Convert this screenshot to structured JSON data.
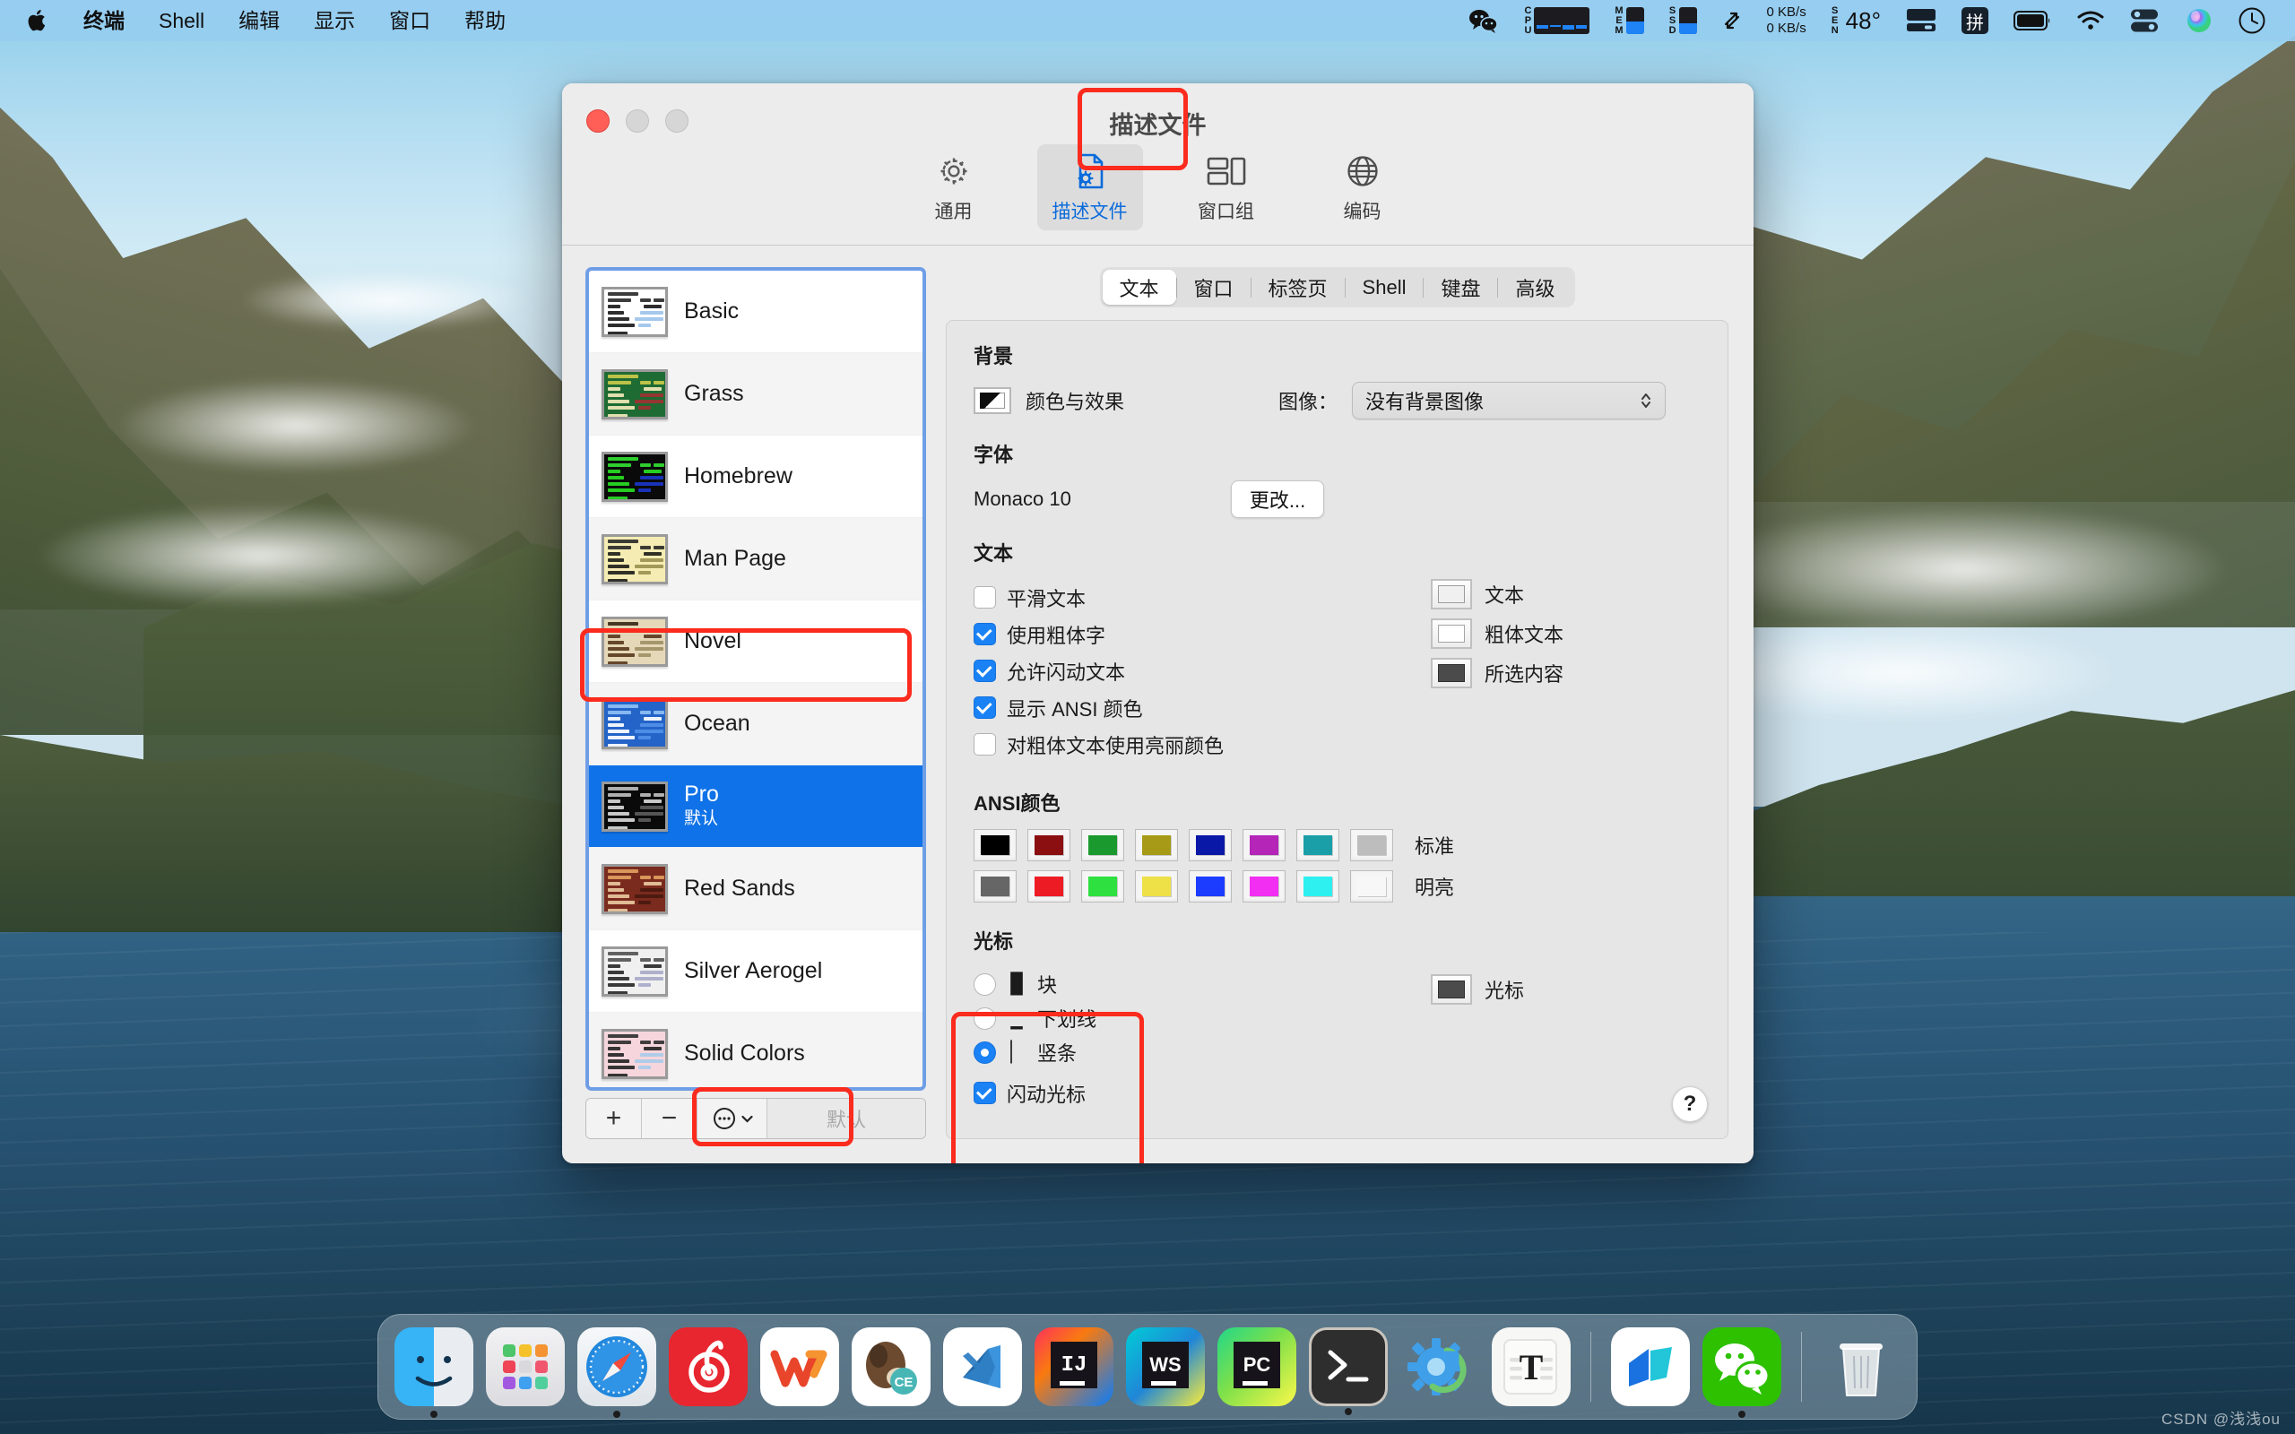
{
  "menubar": {
    "apple_icon": "apple-logo-icon",
    "items": [
      {
        "label": "终端",
        "bold": true
      },
      {
        "label": "Shell",
        "bold": false
      },
      {
        "label": "编辑",
        "bold": false
      },
      {
        "label": "显示",
        "bold": false
      },
      {
        "label": "窗口",
        "bold": false
      },
      {
        "label": "帮助",
        "bold": false
      }
    ],
    "status": {
      "wechat_icon": "wechat-icon",
      "cpu_label": "CPU",
      "mem_label": "MEM",
      "ssd_label": "SSD",
      "net_up": "0 KB/s",
      "net_down": "0 KB/s",
      "sen_label": "SEN",
      "temperature": "48°",
      "display_icon": "display-icon",
      "input_method": "拼",
      "battery_icon": "battery-icon",
      "wifi_icon": "wifi-icon",
      "control_center_icon": "control-center-icon",
      "siri_icon": "siri-icon",
      "clock_icon": "clock-icon"
    }
  },
  "window": {
    "title": "描述文件",
    "traffic_lights": [
      "close-button",
      "minimize-button",
      "zoom-button"
    ],
    "toolbar": [
      {
        "label": "通用",
        "icon": "gear-icon",
        "active": false
      },
      {
        "label": "描述文件",
        "icon": "profile-document-icon",
        "active": true
      },
      {
        "label": "窗口组",
        "icon": "window-group-icon",
        "active": false
      },
      {
        "label": "编码",
        "icon": "globe-icon",
        "active": false
      }
    ]
  },
  "profiles": {
    "items": [
      {
        "name": "Basic",
        "subtitle": "",
        "selected": false,
        "bg": "#ffffff",
        "fg": "#1b1b1b",
        "accent": "#9dc4ea",
        "hdr": "#2b2b2b"
      },
      {
        "name": "Grass",
        "subtitle": "",
        "selected": false,
        "bg": "#1e6b33",
        "fg": "#f2e9b8",
        "accent": "#9e3232",
        "hdr": "#caca4a"
      },
      {
        "name": "Homebrew",
        "subtitle": "",
        "selected": false,
        "bg": "#0a0a0a",
        "fg": "#28e024",
        "accent": "#1b36c8",
        "hdr": "#32e032"
      },
      {
        "name": "Man Page",
        "subtitle": "",
        "selected": false,
        "bg": "#f5ecb3",
        "fg": "#20201a",
        "accent": "#9b9150",
        "hdr": "#2a2a2a"
      },
      {
        "name": "Novel",
        "subtitle": "",
        "selected": false,
        "bg": "#e5d8b8",
        "fg": "#5a3b20",
        "accent": "#a09065",
        "hdr": "#3a2a18"
      },
      {
        "name": "Ocean",
        "subtitle": "",
        "selected": false,
        "bg": "#2463c8",
        "fg": "#ffffff",
        "accent": "#5390e8",
        "hdr": "#8fc0f5"
      },
      {
        "name": "Pro",
        "subtitle": "默认",
        "selected": true,
        "bg": "#0a0a0a",
        "fg": "#d8d8d8",
        "accent": "#5c5c5c",
        "hdr": "#bdbdbd"
      },
      {
        "name": "Red Sands",
        "subtitle": "",
        "selected": false,
        "bg": "#7a2b1e",
        "fg": "#e8c9a0",
        "accent": "#4a190f",
        "hdr": "#e0a060"
      },
      {
        "name": "Silver Aerogel",
        "subtitle": "",
        "selected": false,
        "bg": "#f0f0f0",
        "fg": "#2a2a2a",
        "accent": "#a9aac8",
        "hdr": "#555555"
      },
      {
        "name": "Solid Colors",
        "subtitle": "",
        "selected": false,
        "bg": "#f6d6dc",
        "fg": "#252525",
        "accent": "#a8cbe8",
        "hdr": "#303030"
      }
    ],
    "thumb_prompt": "Terminal#",
    "footer": {
      "add_label": "+",
      "remove_label": "−",
      "more_label": "⋯",
      "default_label": "默认"
    }
  },
  "tabs": [
    {
      "label": "文本",
      "active": true
    },
    {
      "label": "窗口",
      "active": false
    },
    {
      "label": "标签页",
      "active": false
    },
    {
      "label": "Shell",
      "active": false
    },
    {
      "label": "键盘",
      "active": false
    },
    {
      "label": "高级",
      "active": false
    }
  ],
  "text_tab": {
    "background": {
      "section_title": "背景",
      "color_effects_label": "颜色与效果",
      "color_swatch": "#0d0d0d",
      "image_label": "图像：",
      "image_value": "没有背景图像"
    },
    "font": {
      "section_title": "字体",
      "value": "Monaco 10",
      "change_button": "更改..."
    },
    "text": {
      "section_title": "文本",
      "checkboxes": [
        {
          "label": "平滑文本",
          "checked": false
        },
        {
          "label": "使用粗体字",
          "checked": true
        },
        {
          "label": "允许闪动文本",
          "checked": true
        },
        {
          "label": "显示 ANSI 颜色",
          "checked": true
        },
        {
          "label": "对粗体文本使用亮丽颜色",
          "checked": false
        }
      ],
      "swatches": [
        {
          "label": "文本",
          "color": "#f0f0f0"
        },
        {
          "label": "粗体文本",
          "color": "#ffffff"
        },
        {
          "label": "所选内容",
          "color": "#4b4b4b"
        }
      ]
    },
    "ansi": {
      "section_title": "ANSI颜色",
      "normal_label": "标准",
      "bright_label": "明亮",
      "normal": [
        "#000000",
        "#8b0f11",
        "#1a9a2e",
        "#a79a17",
        "#0a18a8",
        "#b425b8",
        "#1a9fa8",
        "#bdbdbd"
      ],
      "bright": [
        "#666666",
        "#ed1c24",
        "#2ee040",
        "#eee047",
        "#1c3dff",
        "#f12ef1",
        "#2ef0f0",
        "#f7f7f7"
      ]
    },
    "cursor": {
      "section_title": "光标",
      "options": [
        {
          "label": "块",
          "glyph": "█",
          "selected": false
        },
        {
          "label": "下划线",
          "glyph": "▁",
          "selected": false
        },
        {
          "label": "竖条",
          "glyph": "▏",
          "selected": true
        }
      ],
      "blink_label": "闪动光标",
      "blink_checked": true,
      "swatch_label": "光标",
      "swatch_color": "#4b4b4b"
    },
    "help_label": "?"
  },
  "dock": {
    "items": [
      {
        "name": "finder",
        "running": true
      },
      {
        "name": "launchpad",
        "running": false
      },
      {
        "name": "safari",
        "running": true
      },
      {
        "name": "netease-music",
        "running": false
      },
      {
        "name": "wps-office",
        "running": false
      },
      {
        "name": "dbeaver",
        "running": false
      },
      {
        "name": "vscode",
        "running": false
      },
      {
        "name": "intellij-idea",
        "running": false
      },
      {
        "name": "webstorm",
        "running": false
      },
      {
        "name": "pycharm",
        "running": false
      },
      {
        "name": "terminal",
        "running": true
      },
      {
        "name": "system-settings",
        "running": false
      },
      {
        "name": "typora",
        "running": false
      },
      {
        "name": "separator",
        "running": false
      },
      {
        "name": "dingtalk",
        "running": false
      },
      {
        "name": "wechat",
        "running": true
      },
      {
        "name": "separator",
        "running": false
      },
      {
        "name": "trash",
        "running": false
      }
    ]
  },
  "watermark": "CSDN @浅浅ou"
}
